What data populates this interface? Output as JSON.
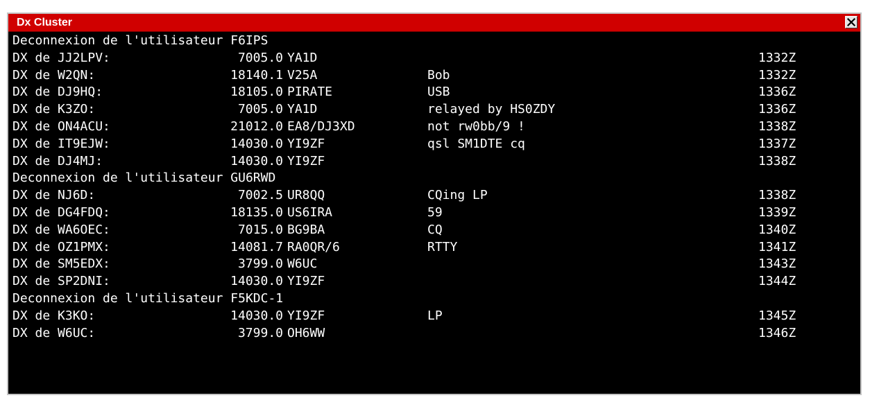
{
  "window": {
    "title": "Dx Cluster",
    "close_icon": "close-icon",
    "colors": {
      "titlebar": "#d00000",
      "console_bg": "#000000",
      "console_text": "#ffffff"
    }
  },
  "console": {
    "lines": [
      {
        "type": "info",
        "text": "Deconnexion de l'utilisateur F6IPS"
      },
      {
        "type": "spot",
        "spotter": "DX de JJ2LPV:",
        "freq": "7005.0",
        "dx": "YA1D",
        "comment": "",
        "time": "1332Z"
      },
      {
        "type": "spot",
        "spotter": "DX de W2QN:",
        "freq": "18140.1",
        "dx": "V25A",
        "comment": "Bob",
        "time": "1332Z"
      },
      {
        "type": "spot",
        "spotter": "DX de DJ9HQ:",
        "freq": "18105.0",
        "dx": "PIRATE",
        "comment": "USB",
        "time": "1336Z"
      },
      {
        "type": "spot",
        "spotter": "DX de K3ZO:",
        "freq": "7005.0",
        "dx": "YA1D",
        "comment": "relayed by HS0ZDY",
        "time": "1336Z"
      },
      {
        "type": "spot",
        "spotter": "DX de ON4ACU:",
        "freq": "21012.0",
        "dx": "EA8/DJ3XD",
        "comment": "not rw0bb/9 !",
        "time": "1338Z"
      },
      {
        "type": "spot",
        "spotter": "DX de IT9EJW:",
        "freq": "14030.0",
        "dx": "YI9ZF",
        "comment": "qsl SM1DTE cq",
        "time": "1337Z"
      },
      {
        "type": "spot",
        "spotter": "DX de DJ4MJ:",
        "freq": "14030.0",
        "dx": "YI9ZF",
        "comment": "",
        "time": "1338Z"
      },
      {
        "type": "info",
        "text": "Deconnexion de l'utilisateur GU6RWD"
      },
      {
        "type": "spot",
        "spotter": "DX de NJ6D:",
        "freq": "7002.5",
        "dx": "UR8QQ",
        "comment": "CQing LP",
        "time": "1338Z"
      },
      {
        "type": "spot",
        "spotter": "DX de DG4FDQ:",
        "freq": "18135.0",
        "dx": "US6IRA",
        "comment": "59",
        "time": "1339Z"
      },
      {
        "type": "spot",
        "spotter": "DX de WA6OEC:",
        "freq": "7015.0",
        "dx": "BG9BA",
        "comment": "CQ",
        "time": "1340Z"
      },
      {
        "type": "spot",
        "spotter": "DX de OZ1PMX:",
        "freq": "14081.7",
        "dx": "RA0QR/6",
        "comment": "RTTY",
        "time": "1341Z"
      },
      {
        "type": "spot",
        "spotter": "DX de SM5EDX:",
        "freq": "3799.0",
        "dx": "W6UC",
        "comment": "",
        "time": "1343Z"
      },
      {
        "type": "spot",
        "spotter": "DX de SP2DNI:",
        "freq": "14030.0",
        "dx": "YI9ZF",
        "comment": "",
        "time": "1344Z"
      },
      {
        "type": "info",
        "text": "Deconnexion de l'utilisateur F5KDC-1"
      },
      {
        "type": "spot",
        "spotter": "DX de K3KO:",
        "freq": "14030.0",
        "dx": "YI9ZF",
        "comment": "LP",
        "time": "1345Z"
      },
      {
        "type": "spot",
        "spotter": "DX de W6UC:",
        "freq": "3799.0",
        "dx": "OH6WW",
        "comment": "",
        "time": "1346Z"
      }
    ]
  }
}
